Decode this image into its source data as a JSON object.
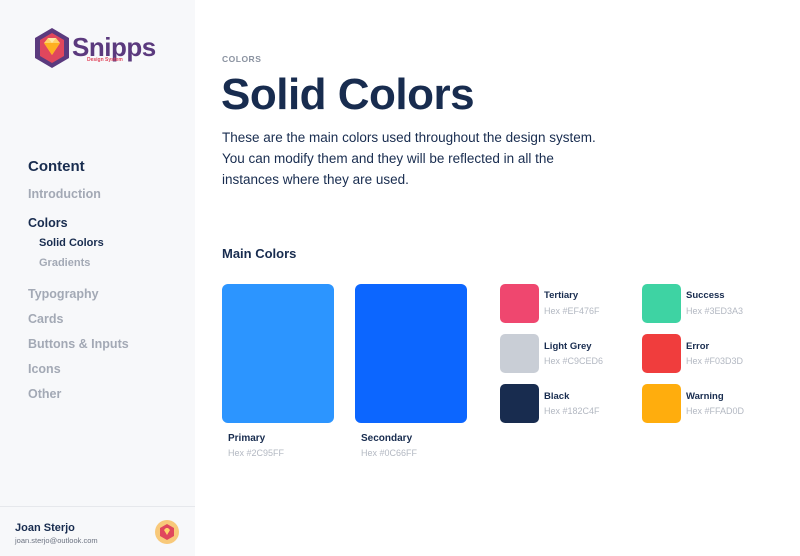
{
  "brand": {
    "name": "Snipps",
    "subtitle": "Design System"
  },
  "sidebar": {
    "heading": "Content",
    "items": [
      {
        "label": "Introduction"
      },
      {
        "label": "Colors"
      },
      {
        "label": "Solid Colors"
      },
      {
        "label": "Gradients"
      },
      {
        "label": "Typography"
      },
      {
        "label": "Cards"
      },
      {
        "label": "Buttons & Inputs"
      },
      {
        "label": "Icons"
      },
      {
        "label": "Other"
      }
    ]
  },
  "user": {
    "name": "Joan Sterjo",
    "email": "joan.sterjo@outlook.com"
  },
  "page": {
    "eyebrow": "COLORS",
    "title": "Solid Colors",
    "description": "These are the main colors used throughout the design system. You can modify them and they will be reflected in all the instances where they are used."
  },
  "main_colors": {
    "title": "Main Colors",
    "primary": {
      "name": "Primary",
      "hex": "Hex #2C95FF",
      "color": "#2C95FF"
    },
    "secondary": {
      "name": "Secondary",
      "hex": "Hex #0C66FF",
      "color": "#0C66FF"
    },
    "tertiary": {
      "name": "Tertiary",
      "hex": "Hex #EF476F",
      "color": "#EF476F"
    },
    "light_grey": {
      "name": "Light Grey",
      "hex": "Hex #C9CED6",
      "color": "#C9CED6"
    },
    "black": {
      "name": "Black",
      "hex": "Hex #182C4F",
      "color": "#182C4F"
    },
    "success": {
      "name": "Success",
      "hex": "Hex #3ED3A3",
      "color": "#3ED3A3"
    },
    "error": {
      "name": "Error",
      "hex": "Hex #F03D3D",
      "color": "#F03D3D"
    },
    "warning": {
      "name": "Warning",
      "hex": "Hex #FFAD0D",
      "color": "#FFAD0D"
    }
  },
  "icons": {
    "logo": "sketch-diamond-hexagon-logo",
    "avatar": "sketch-diamond-avatar"
  }
}
